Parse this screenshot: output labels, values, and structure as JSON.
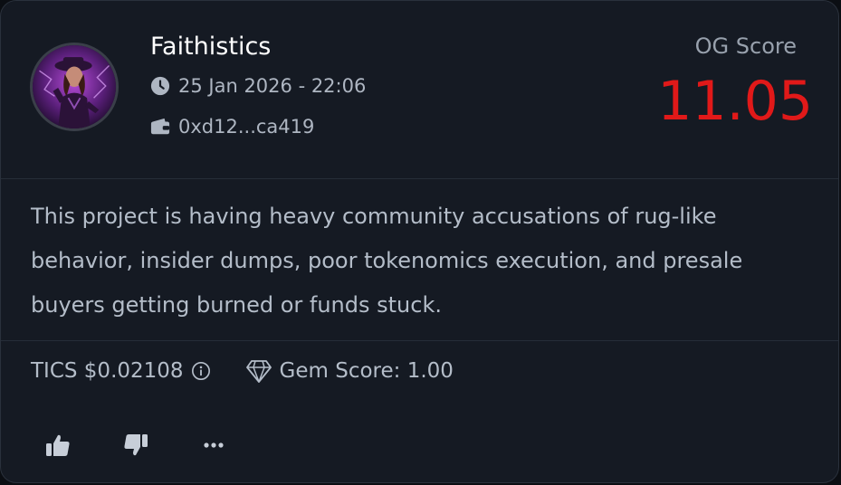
{
  "post": {
    "author": "Faithistics",
    "timestamp": "25 Jan 2026 - 22:06",
    "wallet": "0xd12...ca419",
    "og_label": "OG Score",
    "og_value": "11.05",
    "description": "This project is having heavy community accusations of rug-like behavior, insider dumps, poor tokenomics execution, and presale buyers getting burned or funds stuck.",
    "price": "TICS $0.02108",
    "gem_score": "Gem Score: 1.00"
  },
  "icons": {
    "date": "clock-icon",
    "wallet": "wallet-icon",
    "info": "info-icon",
    "gem": "diamond-icon",
    "like": "thumbs-up-icon",
    "dislike": "thumbs-down-icon",
    "more": "more-icon"
  },
  "colors": {
    "og_score": "#e11919",
    "background": "#151a23",
    "text": "#b4bdc9"
  }
}
